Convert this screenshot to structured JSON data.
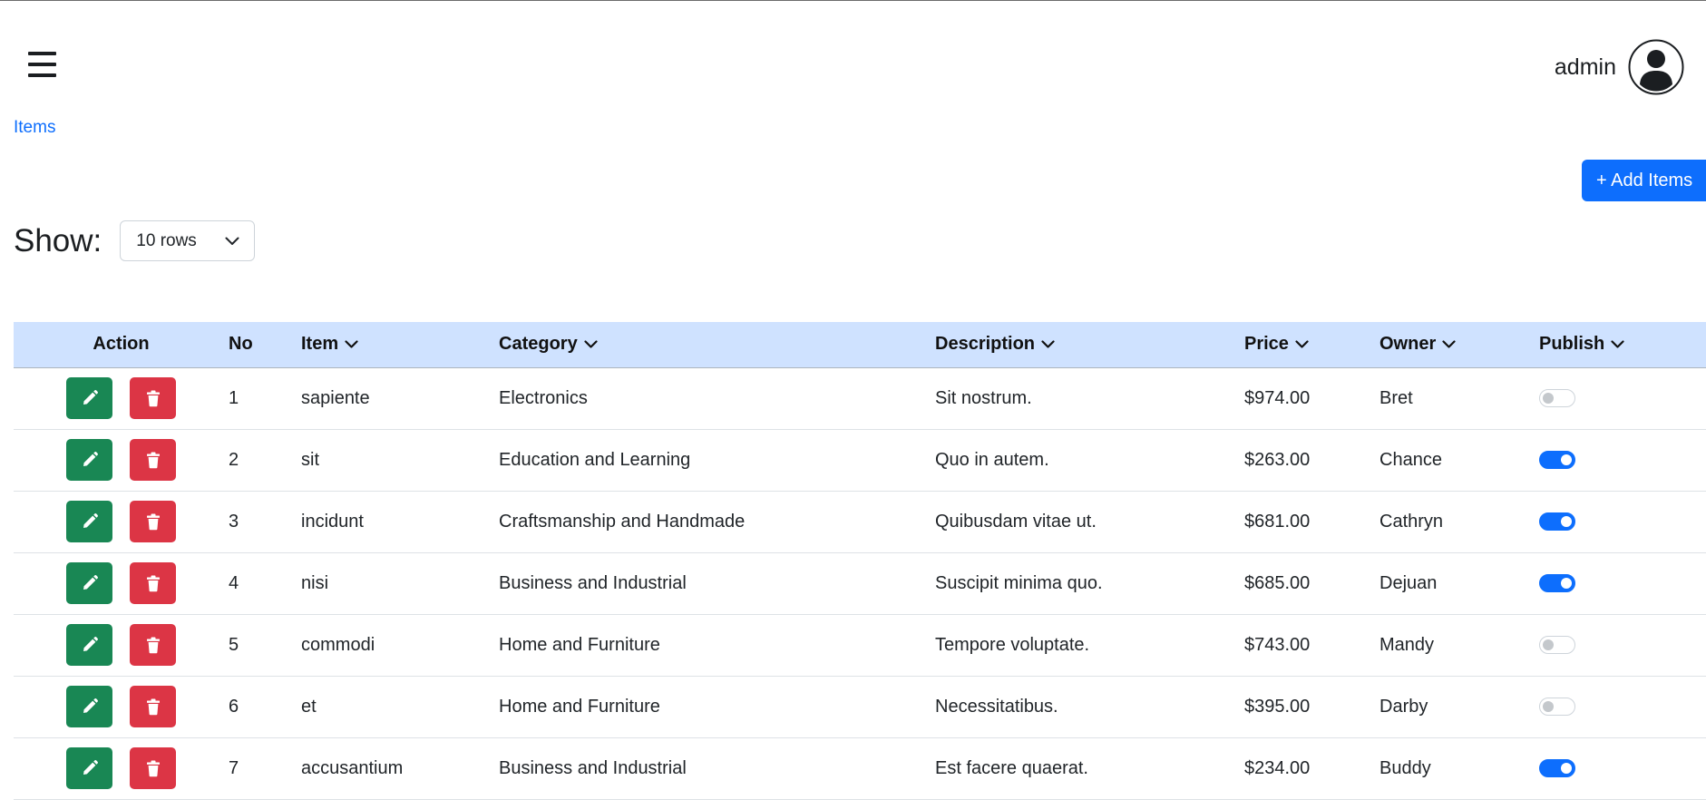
{
  "header": {
    "menu_icon": "hamburger-menu-icon",
    "username": "admin",
    "avatar_icon": "user-circle-icon"
  },
  "breadcrumb": {
    "label": "Items"
  },
  "toolbar": {
    "add_label": "+ Add Items"
  },
  "show": {
    "label": "Show:",
    "selected": "10 rows"
  },
  "table": {
    "columns": [
      "Action",
      "No",
      "Item",
      "Category",
      "Description",
      "Price",
      "Owner",
      "Publish"
    ],
    "rows": [
      {
        "no": "1",
        "item": "sapiente",
        "category": "Electronics",
        "description": "Sit nostrum.",
        "price": "$974.00",
        "owner": "Bret",
        "publish": false
      },
      {
        "no": "2",
        "item": "sit",
        "category": "Education and Learning",
        "description": "Quo in autem.",
        "price": "$263.00",
        "owner": "Chance",
        "publish": true
      },
      {
        "no": "3",
        "item": "incidunt",
        "category": "Craftsmanship and Handmade",
        "description": "Quibusdam vitae ut.",
        "price": "$681.00",
        "owner": "Cathryn",
        "publish": true
      },
      {
        "no": "4",
        "item": "nisi",
        "category": "Business and Industrial",
        "description": "Suscipit minima quo.",
        "price": "$685.00",
        "owner": "Dejuan",
        "publish": true
      },
      {
        "no": "5",
        "item": "commodi",
        "category": "Home and Furniture",
        "description": "Tempore voluptate.",
        "price": "$743.00",
        "owner": "Mandy",
        "publish": false
      },
      {
        "no": "6",
        "item": "et",
        "category": "Home and Furniture",
        "description": "Necessitatibus.",
        "price": "$395.00",
        "owner": "Darby",
        "publish": false
      },
      {
        "no": "7",
        "item": "accusantium",
        "category": "Business and Industrial",
        "description": "Est facere quaerat.",
        "price": "$234.00",
        "owner": "Buddy",
        "publish": true
      }
    ]
  },
  "colors": {
    "primary": "#0d6efd",
    "edit": "#198754",
    "delete": "#dc3545",
    "header_row": "#cfe2ff"
  }
}
